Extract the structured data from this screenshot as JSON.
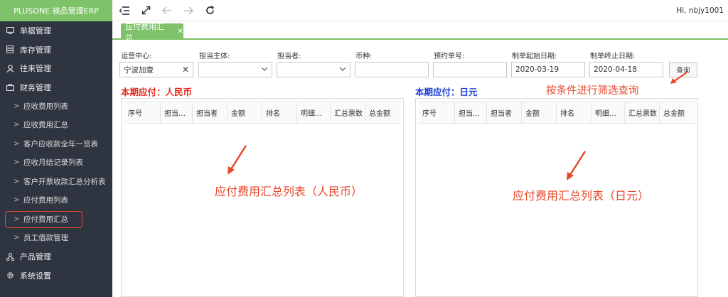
{
  "app": {
    "brand": "PLUSONE 検品管理ERP"
  },
  "user": {
    "greeting": "Hi, nbjy1001"
  },
  "sidebar": {
    "groups_top": [
      {
        "label": "单据管理",
        "icon": "monitor-icon"
      },
      {
        "label": "库存管理",
        "icon": "database-icon"
      },
      {
        "label": "往来管理",
        "icon": "user-icon"
      },
      {
        "label": "财务管理",
        "icon": "briefcase-icon"
      }
    ],
    "finance_items": [
      {
        "label": "应收费用列表"
      },
      {
        "label": "应收费用汇总"
      },
      {
        "label": "客户应收款全年一览表"
      },
      {
        "label": "应收月结记录列表"
      },
      {
        "label": "客户开票收款汇总分析表"
      },
      {
        "label": "应付费用列表"
      },
      {
        "label": "应付费用汇总",
        "active": true
      },
      {
        "label": "员工借款管理"
      }
    ],
    "groups_bottom": [
      {
        "label": "产品管理",
        "icon": "sitemap-icon"
      },
      {
        "label": "系统设置",
        "icon": "gear-icon"
      }
    ]
  },
  "toolbar": {
    "icons": [
      "menu-collapse-icon",
      "fullscreen-icon",
      "back-arrow-icon",
      "forward-arrow-icon",
      "refresh-icon"
    ]
  },
  "tabs": [
    {
      "label": "应付费用汇总"
    }
  ],
  "filters": {
    "operation_center": {
      "label": "运营中心:",
      "value": "宁波加壹"
    },
    "subject": {
      "label": "担当主体:",
      "value": ""
    },
    "person": {
      "label": "担当者:",
      "value": ""
    },
    "currency": {
      "label": "币种:",
      "value": ""
    },
    "booking_no": {
      "label": "预约单号:",
      "value": ""
    },
    "start_date": {
      "label": "制单起始日期:",
      "value": "2020-03-19"
    },
    "end_date": {
      "label": "制单终止日期:",
      "value": "2020-04-18"
    },
    "query_button": "查询"
  },
  "sections": {
    "rmb": {
      "title": "本期应付：人民币",
      "color": "#e8291c"
    },
    "jpy": {
      "title": "本期应付：日元",
      "color": "#1a3fd6"
    }
  },
  "table_columns": [
    "序号",
    "担当…",
    "担当者",
    "金额",
    "排名",
    "明细…",
    "汇总票数",
    "总金额"
  ],
  "annotations": {
    "query_hint": "按条件进行筛选查询",
    "rmb_list": "应付费用汇总列表（人民币）",
    "jpy_list": "应付费用汇总列表（日元）"
  },
  "colors": {
    "accent_green": "#7ec26a",
    "sidebar_bg": "#2f3540",
    "annotation_red": "#e8472a"
  }
}
